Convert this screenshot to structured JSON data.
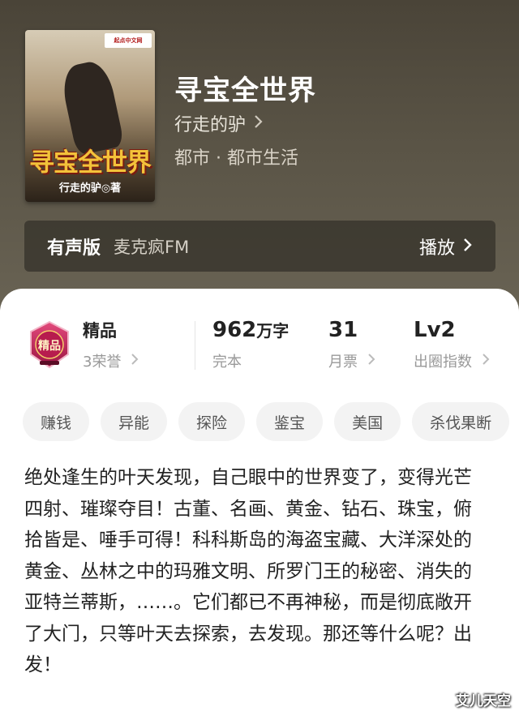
{
  "book": {
    "title": "寻宝全世界",
    "author": "行走的驴",
    "genre": "都市 · 都市生活",
    "cover": {
      "title": "寻宝全世界",
      "author": "行走的驴◎著",
      "publisher_tag": "起点中文网"
    }
  },
  "audio": {
    "label": "有声版",
    "source": "麦克疯FM",
    "play_label": "播放"
  },
  "stats": {
    "badge_title": "精品",
    "badge_sub": "3荣誉",
    "badge_icon_text": "精品",
    "words_value": "962",
    "words_unit": "万字",
    "words_status": "完本",
    "tickets_value": "31",
    "tickets_label": "月票",
    "level_value": "Lv2",
    "level_label": "出圈指数"
  },
  "tags": [
    "赚钱",
    "异能",
    "探险",
    "鉴宝",
    "美国",
    "杀伐果断"
  ],
  "description": "绝处逢生的叶天发现，自己眼中的世界变了，变得光芒四射、璀璨夺目！古董、名画、黄金、钻石、珠宝，俯拾皆是、唾手可得！科科斯岛的海盗宝藏、大洋深处的黄金、丛林之中的玛雅文明、所罗门王的秘密、消失的亚特兰蒂斯，……。它们都已不再神秘，而是彻底敞开了大门，只等叶天去探索，去发现。那还等什么呢？出发！",
  "watermark": "艾儿天空",
  "icons": {
    "chevron": "chevron-right-icon",
    "badge": "premium-badge-icon"
  },
  "colors": {
    "hero_bg": "#5a5446",
    "badge_red": "#c2185b",
    "cover_title": "#f3c23a"
  }
}
